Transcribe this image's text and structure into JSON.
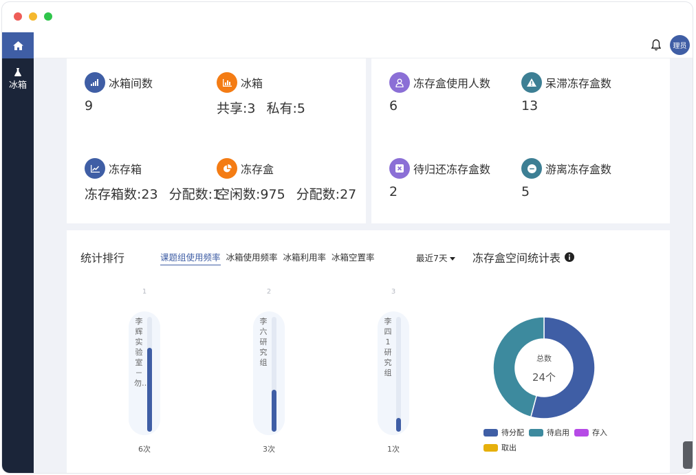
{
  "sidebar": {
    "home_icon": "home-icon",
    "items": [
      {
        "label": "冰箱",
        "icon": "flask-icon"
      }
    ]
  },
  "header": {
    "bell_icon": "bell-icon",
    "avatar_text": "理员"
  },
  "stats_left": [
    {
      "title": "冰箱间数",
      "icon": "signal-icon",
      "color": "#3f5ea5",
      "values": [
        "9"
      ]
    },
    {
      "title": "冰箱",
      "icon": "bar-chart-icon",
      "color": "#f47c14",
      "values": [
        "共享:3",
        "私有:5"
      ]
    },
    {
      "title": "冻存箱",
      "icon": "line-chart-icon",
      "color": "#3f5ea5",
      "values": [
        "冻存箱数:23",
        "分配数:1"
      ]
    },
    {
      "title": "冻存盒",
      "icon": "pie-chart-icon",
      "color": "#f47c14",
      "values": [
        "空闲数:975",
        "分配数:27"
      ]
    }
  ],
  "stats_right": [
    {
      "title": "冻存盒使用人数",
      "icon": "user-icon",
      "color": "#8b6fd6",
      "values": [
        "6"
      ]
    },
    {
      "title": "呆滞冻存盒数",
      "icon": "warning-icon",
      "color": "#3d7f94",
      "values": [
        "13"
      ]
    },
    {
      "title": "待归还冻存盒数",
      "icon": "close-box-icon",
      "color": "#8b6fd6",
      "values": [
        "2"
      ]
    },
    {
      "title": "游离冻存盒数",
      "icon": "minus-circle-icon",
      "color": "#3d7f94",
      "values": [
        "5"
      ]
    }
  ],
  "ranking": {
    "title": "统计排行",
    "tabs": [
      "课题组使用频率",
      "冰箱使用频率",
      "冰箱利用率",
      "冰箱空置率"
    ],
    "active_tab": 0,
    "range_label": "最近7天",
    "max_count": 6,
    "items": [
      {
        "rank": "1",
        "name": "李辉实验室－勿…",
        "count": 6,
        "count_label": "6次"
      },
      {
        "rank": "2",
        "name": "李六研究组",
        "count": 3,
        "count_label": "3次"
      },
      {
        "rank": "3",
        "name": "李四1研究组",
        "count": 1,
        "count_label": "1次"
      }
    ]
  },
  "space": {
    "title": "冻存盒空间统计表",
    "info_icon": "info-icon"
  },
  "chart_data": {
    "type": "pie",
    "center_label": "总数",
    "center_value": "24个",
    "categories": [
      "待分配",
      "待启用",
      "存入",
      "取出"
    ],
    "values": [
      13,
      11,
      0,
      0
    ],
    "colors": [
      "#3f5ea5",
      "#3d8a9e",
      "#b64ae6",
      "#e6b00c"
    ],
    "legend": "bottom"
  }
}
